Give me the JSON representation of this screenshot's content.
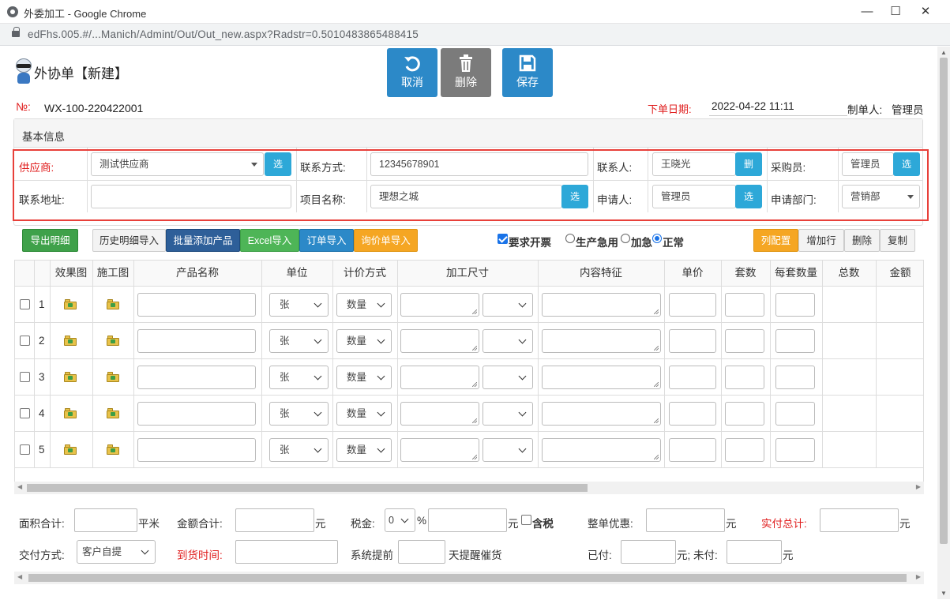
{
  "window": {
    "title": "外委加工 - Google Chrome",
    "url": "edFhs.005.#/...Manich/Admint/Out/Out_new.aspx?Radstr=0.5010483865488415"
  },
  "header": {
    "title": "外协单【新建】"
  },
  "toolbar": {
    "cancel": "取消",
    "delete": "删除",
    "save": "保存"
  },
  "order": {
    "no_label": "№:",
    "no_value": "WX-100-220422001",
    "date_label": "下单日期:",
    "date_value": "2022-04-22 11:11",
    "maker_label": "制单人:",
    "maker_value": "管理员"
  },
  "basic": {
    "title": "基本信息",
    "supplier_label": "供应商:",
    "supplier_value": "测试供应商",
    "contact_label": "联系方式:",
    "contact_value": "12345678901",
    "person_label": "联系人:",
    "person_value": "王晓光",
    "buyer_label": "采购员:",
    "buyer_value": "管理员",
    "address_label": "联系地址:",
    "address_value": "",
    "project_label": "项目名称:",
    "project_value": "理想之城",
    "applicant_label": "申请人:",
    "applicant_value": "管理员",
    "dept_label": "申请部门:",
    "dept_value": "营销部",
    "select_btn": "选",
    "delete_btn": "删"
  },
  "actions": {
    "export": "导出明细",
    "history": "历史明细导入",
    "batch_add": "批量添加产品",
    "excel": "Excel导入",
    "order_import": "订单导入",
    "quote_import": "询价单导入",
    "invoice": "要求开票",
    "urgent_prod": "生产急用",
    "urgent": "加急",
    "normal": "正常",
    "col_config": "列配置",
    "add_row": "增加行",
    "del_row": "删除",
    "copy": "复制"
  },
  "grid": {
    "headers": [
      "效果图",
      "施工图",
      "产品名称",
      "单位",
      "计价方式",
      "加工尺寸",
      "内容特征",
      "单价",
      "套数",
      "每套数量",
      "总数",
      "金额"
    ],
    "rows": [
      {
        "no": "1",
        "unit": "张",
        "pricing": "数量"
      },
      {
        "no": "2",
        "unit": "张",
        "pricing": "数量"
      },
      {
        "no": "3",
        "unit": "张",
        "pricing": "数量"
      },
      {
        "no": "4",
        "unit": "张",
        "pricing": "数量"
      },
      {
        "no": "5",
        "unit": "张",
        "pricing": "数量"
      }
    ]
  },
  "footer": {
    "area_label": "面积合计:",
    "area_unit": "平米",
    "amount_label": "金额合计:",
    "amount_unit": "元",
    "tax_label": "税金:",
    "tax_value": "0",
    "tax_pct": "%",
    "tax_unit": "元",
    "tax_incl": "含税",
    "discount_label": "整单优惠:",
    "discount_unit": "元",
    "total_label": "实付总计:",
    "total_unit": "元",
    "delivery_label": "交付方式:",
    "delivery_value": "客户自提",
    "arrival_label": "到货时间:",
    "remind_pre": "系统提前",
    "remind_post": "天提醒催货",
    "paid_label": "已付:",
    "unpaid_label": "元; 未付:",
    "unpaid_unit": "元"
  }
}
